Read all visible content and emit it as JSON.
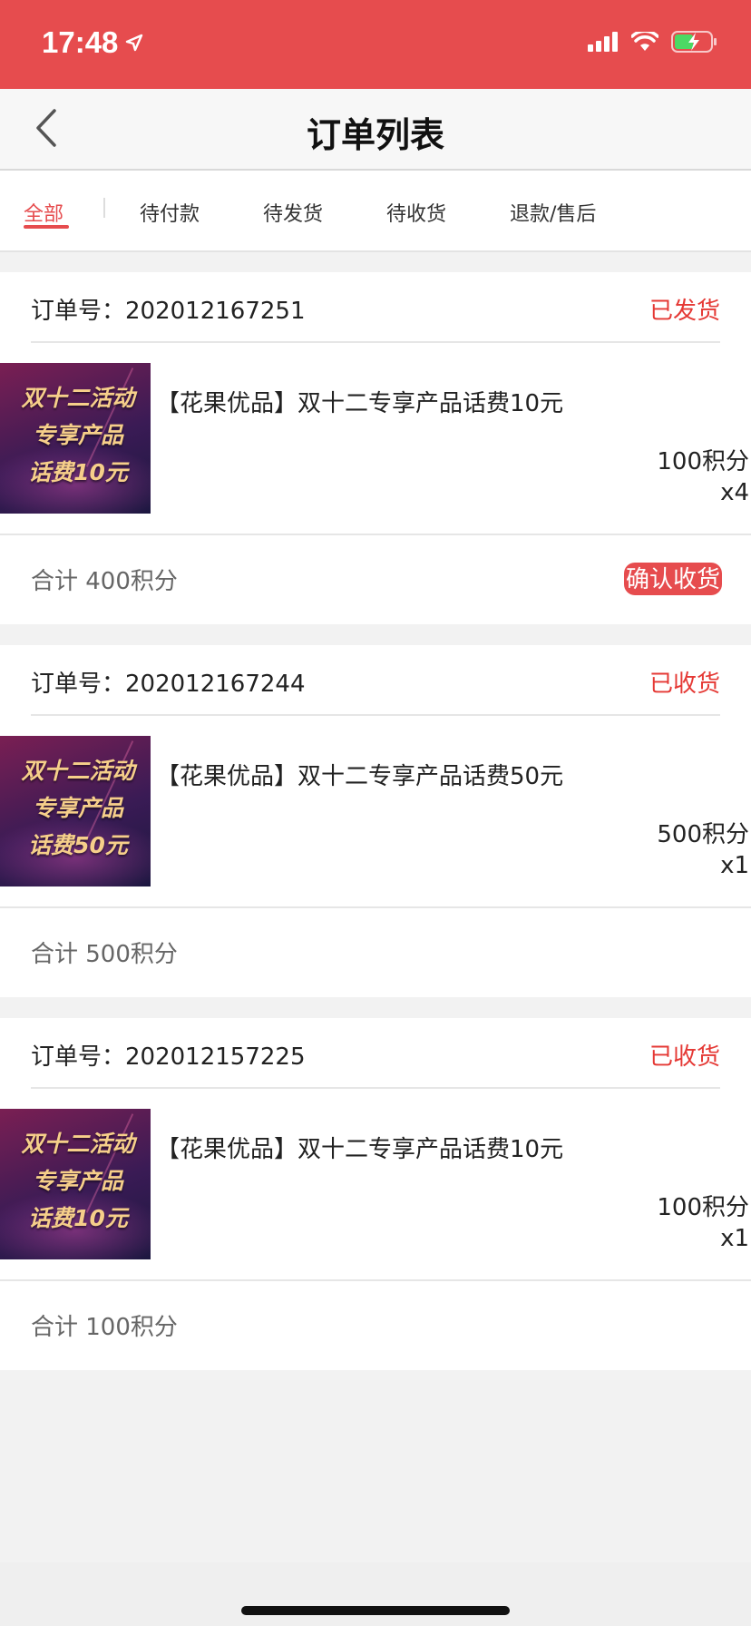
{
  "status_bar": {
    "time": "17:48",
    "icons": [
      "location-arrow-icon",
      "signal-icon",
      "wifi-icon",
      "battery-charging-icon"
    ],
    "color": "#e64c4e"
  },
  "nav": {
    "title": "订单列表",
    "back_icon": "chevron-left-icon"
  },
  "tabs": [
    {
      "label": "全部",
      "active": true
    },
    {
      "label": "待付款",
      "active": false
    },
    {
      "label": "待发货",
      "active": false
    },
    {
      "label": "待收货",
      "active": false
    },
    {
      "label": "退款/售后",
      "active": false
    }
  ],
  "accent_color": "#e64c4e",
  "orders": [
    {
      "order_no_label": "订单号：",
      "order_no": "202012167251",
      "status": "已发货",
      "thumb_lines": [
        "双十二活动",
        "专享产品",
        "话费10元"
      ],
      "product_title": "【花果优品】双十二专享产品话费10元",
      "price": "100积分",
      "qty": "x4",
      "total": "合计 400积分",
      "action": "确认收货"
    },
    {
      "order_no_label": "订单号：",
      "order_no": "202012167244",
      "status": "已收货",
      "thumb_lines": [
        "双十二活动",
        "专享产品",
        "话费50元"
      ],
      "product_title": "【花果优品】双十二专享产品话费50元",
      "price": "500积分",
      "qty": "x1",
      "total": "合计 500积分",
      "action": null
    },
    {
      "order_no_label": "订单号：",
      "order_no": "202012157225",
      "status": "已收货",
      "thumb_lines": [
        "双十二活动",
        "专享产品",
        "话费10元"
      ],
      "product_title": "【花果优品】双十二专享产品话费10元",
      "price": "100积分",
      "qty": "x1",
      "total": "合计 100积分",
      "action": null
    }
  ]
}
